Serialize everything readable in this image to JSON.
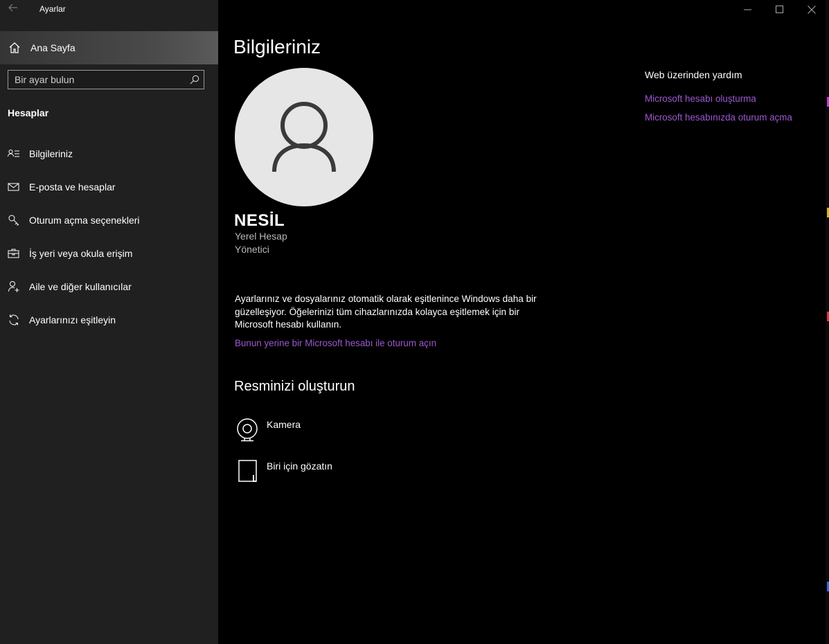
{
  "window": {
    "app_title": "Ayarlar",
    "minimize_icon": "minimize-icon",
    "maximize_icon": "maximize-icon",
    "close_icon": "close-icon"
  },
  "sidebar": {
    "home_label": "Ana Sayfa",
    "search_placeholder": "Bir ayar bulun",
    "section_title": "Hesaplar",
    "items": [
      {
        "label": "Bilgileriniz",
        "icon": "person-list-icon"
      },
      {
        "label": "E-posta ve hesaplar",
        "icon": "mail-icon"
      },
      {
        "label": "Oturum açma seçenekleri",
        "icon": "key-icon"
      },
      {
        "label": "İş yeri veya okula erişim",
        "icon": "briefcase-icon"
      },
      {
        "label": "Aile ve diğer kullanıcılar",
        "icon": "person-add-icon"
      },
      {
        "label": "Ayarlarınızı eşitleyin",
        "icon": "sync-icon"
      }
    ]
  },
  "main": {
    "title": "Bilgileriniz",
    "user": {
      "name": "NESİL",
      "account_type": "Yerel Hesap",
      "role": "Yönetici"
    },
    "info_text": "Ayarlarınız ve dosyalarınız otomatik olarak eşitlenince Windows daha bir güzelleşiyor. Öğelerinizi tüm cihazlarınızda kolayca eşitlemek için bir Microsoft hesabı kullanın.",
    "ms_signin_link": "Bunun yerine bir Microsoft hesabı ile oturum açın",
    "create_picture_title": "Resminizi oluşturun",
    "picture_options": [
      {
        "label": "Kamera",
        "icon": "webcam-icon"
      },
      {
        "label": "Biri için gözatın",
        "icon": "document-icon"
      }
    ]
  },
  "help": {
    "title": "Web üzerinden yardım",
    "links": [
      "Microsoft hesabı oluşturma",
      "Microsoft hesabınızda oturum açma"
    ]
  },
  "colors": {
    "sidebar_bg": "#202020",
    "main_bg": "#000000",
    "link": "#9b59d0"
  }
}
